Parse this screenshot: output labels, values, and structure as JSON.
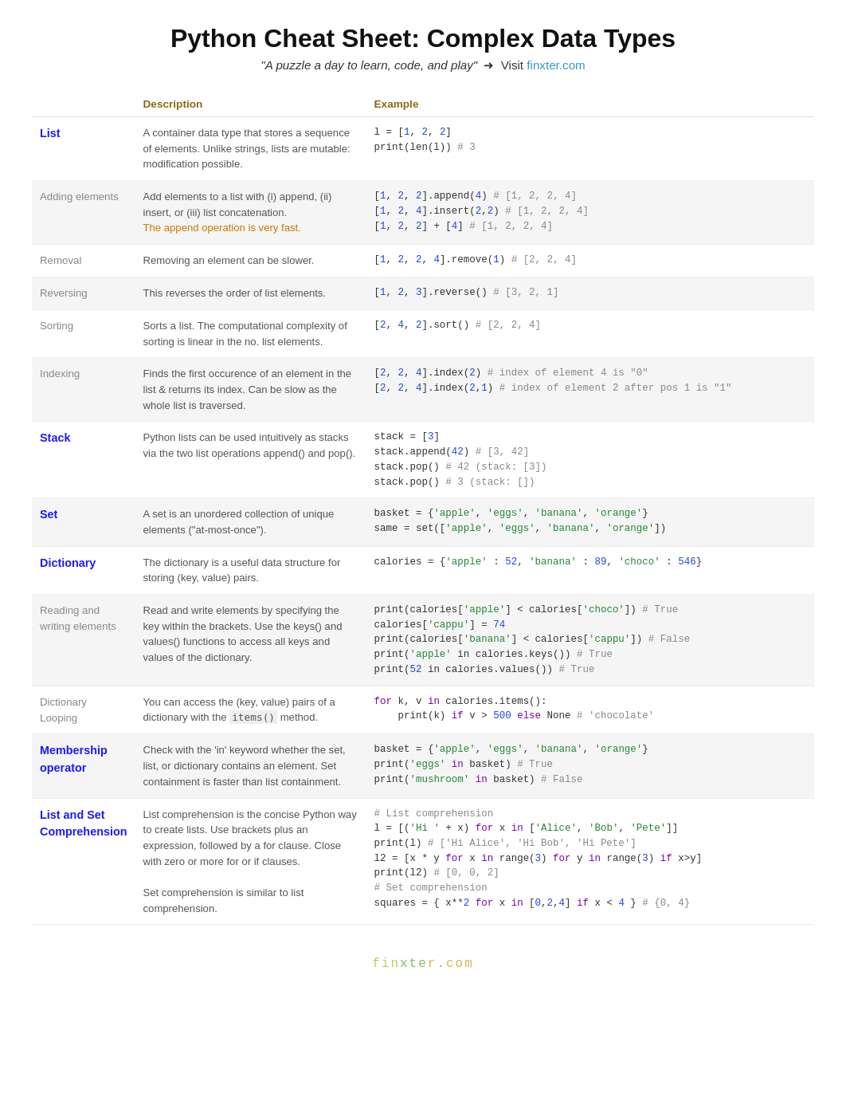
{
  "title": "Python Cheat Sheet: Complex Data Types",
  "subtitle_quote": "\"A puzzle a day to learn, code, and play\"",
  "subtitle_arrow": "➜",
  "subtitle_visit": "Visit",
  "subtitle_link": "finxter.com",
  "subtitle_link_url": "#",
  "col_headers": [
    "",
    "Description",
    "Example"
  ],
  "rows": [
    {
      "id": "list",
      "label": "List",
      "label_bold": true,
      "label_blue": true,
      "desc": "A container data type that stores a sequence of elements. Unlike strings, lists are mutable: modification possible.",
      "highlight": false
    },
    {
      "id": "adding-elements",
      "label": "Adding elements",
      "label_bold": false,
      "label_blue": false,
      "desc": "Add elements to a list with (i) append, (ii) insert, or (iii) list concatenation.\nThe append operation is very fast.",
      "desc_orange_part": "The append operation is very fast.",
      "highlight": true
    },
    {
      "id": "removal",
      "label": "Removal",
      "label_bold": false,
      "label_blue": false,
      "desc": "Removing an element can be slower.",
      "highlight": false
    },
    {
      "id": "reversing",
      "label": "Reversing",
      "label_bold": false,
      "label_blue": false,
      "desc": "This reverses the order of list elements.",
      "highlight": true
    },
    {
      "id": "sorting",
      "label": "Sorting",
      "label_bold": false,
      "label_blue": false,
      "desc": "Sorts a list. The computational complexity of sorting is linear in the no. list elements.",
      "highlight": false
    },
    {
      "id": "indexing",
      "label": "Indexing",
      "label_bold": false,
      "label_blue": false,
      "desc": "Finds the first occurence of an element in the list & returns its index. Can be slow as the whole list is traversed.",
      "highlight": true
    },
    {
      "id": "stack",
      "label": "Stack",
      "label_bold": true,
      "label_blue": true,
      "desc": "Python lists can be used intuitively as stacks via the two list operations append() and pop().",
      "highlight": false
    },
    {
      "id": "set",
      "label": "Set",
      "label_bold": true,
      "label_blue": true,
      "desc": "A set is an unordered collection of unique elements (\"at-most-once\").",
      "highlight": true
    },
    {
      "id": "dictionary",
      "label": "Dictionary",
      "label_bold": true,
      "label_blue": true,
      "desc": "The dictionary is a useful data structure for storing (key, value) pairs.",
      "highlight": false
    },
    {
      "id": "reading-writing",
      "label": "Reading and writing elements",
      "label_bold": false,
      "label_blue": false,
      "desc": "Read and write elements by specifying the key within the brackets. Use the keys() and values() functions to access all keys and values of the dictionary.",
      "highlight": true
    },
    {
      "id": "dict-looping",
      "label": "Dictionary Looping",
      "label_bold": false,
      "label_blue": false,
      "desc": "You can access the (key, value) pairs of a dictionary with the items() method.",
      "highlight": false
    },
    {
      "id": "membership",
      "label": "Membership operator",
      "label_bold": true,
      "label_blue": true,
      "desc": "Check with the 'in' keyword whether the set, list, or dictionary contains an element. Set containment is faster than list containment.",
      "highlight": true
    },
    {
      "id": "comprehension",
      "label": "List and Set Comprehension",
      "label_bold": true,
      "label_blue": true,
      "desc": "List comprehension is the concise Python way to create lists. Use brackets plus an expression, followed by a for clause. Close with zero or more for or if clauses.\n\nSet comprehension is similar to list comprehension.",
      "highlight": false
    }
  ]
}
